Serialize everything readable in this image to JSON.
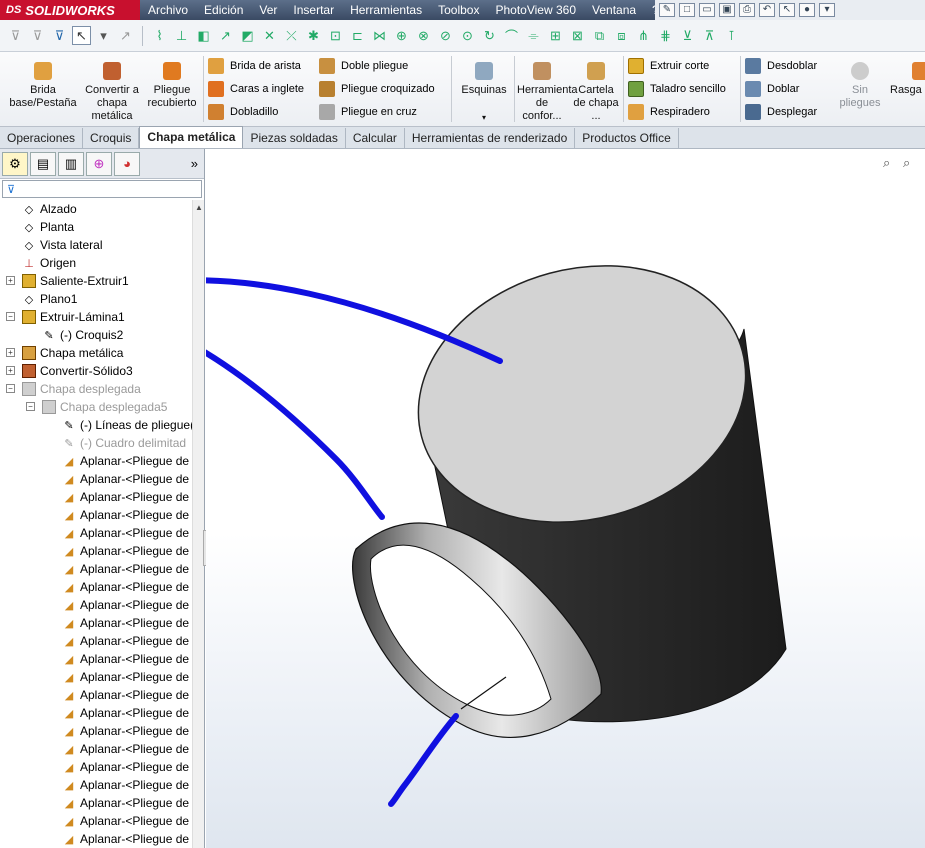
{
  "app": {
    "brand": "SOLIDWORKS",
    "brand_prefix": "DS"
  },
  "menu": [
    "Archivo",
    "Edición",
    "Ver",
    "Insertar",
    "Herramientas",
    "Toolbox",
    "PhotoView 360",
    "Ventana",
    "?"
  ],
  "ribbon": {
    "brida_base": "Brida base/Pestaña",
    "convertir": "Convertir a chapa metálica",
    "pliegue_recubierto": "Pliegue recubierto",
    "brida_arista": "Brida de arista",
    "caras_inglete": "Caras a inglete",
    "dobladillo": "Dobladillo",
    "doble_pliegue": "Doble pliegue",
    "pliegue_croquizado": "Pliegue croquizado",
    "pliegue_cruz": "Pliegue en cruz",
    "esquinas": "Esquinas",
    "herramienta_conformar": "Herramienta de confor...",
    "cartela": "Cartela de chapa ...",
    "extruir_corte": "Extruir corte",
    "taladro_sencillo": "Taladro sencillo",
    "respiradero": "Respiradero",
    "desdoblar": "Desdoblar",
    "doblar": "Doblar",
    "desplegar": "Desplegar",
    "sin_pliegues": "Sin pliegues",
    "rasgar": "Rasga"
  },
  "tabs": [
    "Operaciones",
    "Croquis",
    "Chapa metálica",
    "Piezas soldadas",
    "Calcular",
    "Herramientas de renderizado",
    "Productos Office"
  ],
  "active_tab": "Chapa metálica",
  "pane": {
    "expand_label": "»",
    "filter_icon": "filter-icon"
  },
  "tree": {
    "alzado": "Alzado",
    "planta": "Planta",
    "vista_lateral": "Vista lateral",
    "origen": "Origen",
    "saliente": "Saliente-Extruir1",
    "plano1": "Plano1",
    "extruir_lamina": "Extruir-Lámina1",
    "croquis2": "(-) Croquis2",
    "chapa_metalica": "Chapa metálica",
    "convertir_solido": "Convertir-Sólido3",
    "chapa_desplegada": "Chapa desplegada",
    "chapa_desplegada5": "Chapa desplegada5",
    "lineas_pliegue": "(-) Líneas de pliegue(",
    "cuadro_delimit": "(-) Cuadro delimitad",
    "aplanar": [
      "Aplanar-<Pliegue de",
      "Aplanar-<Pliegue de",
      "Aplanar-<Pliegue de",
      "Aplanar-<Pliegue de",
      "Aplanar-<Pliegue de",
      "Aplanar-<Pliegue de",
      "Aplanar-<Pliegue de",
      "Aplanar-<Pliegue de",
      "Aplanar-<Pliegue de",
      "Aplanar-<Pliegue de",
      "Aplanar-<Pliegue de",
      "Aplanar-<Pliegue de",
      "Aplanar-<Pliegue de",
      "Aplanar-<Pliegue de",
      "Aplanar-<Pliegue de",
      "Aplanar-<Pliegue de",
      "Aplanar-<Pliegue de",
      "Aplanar-<Pliegue de",
      "Aplanar-<Pliegue de",
      "Aplanar-<Pliegue de",
      "Aplanar-<Pliegue de",
      "Aplanar-<Pliegue de",
      "Aplanar-<Pliegue de"
    ]
  },
  "colors": {
    "annotation": "#1010e0",
    "cylinder_top": "#d3d3d3",
    "cylinder_side": "#2e2e2e",
    "menubar": "#3e4e68"
  }
}
